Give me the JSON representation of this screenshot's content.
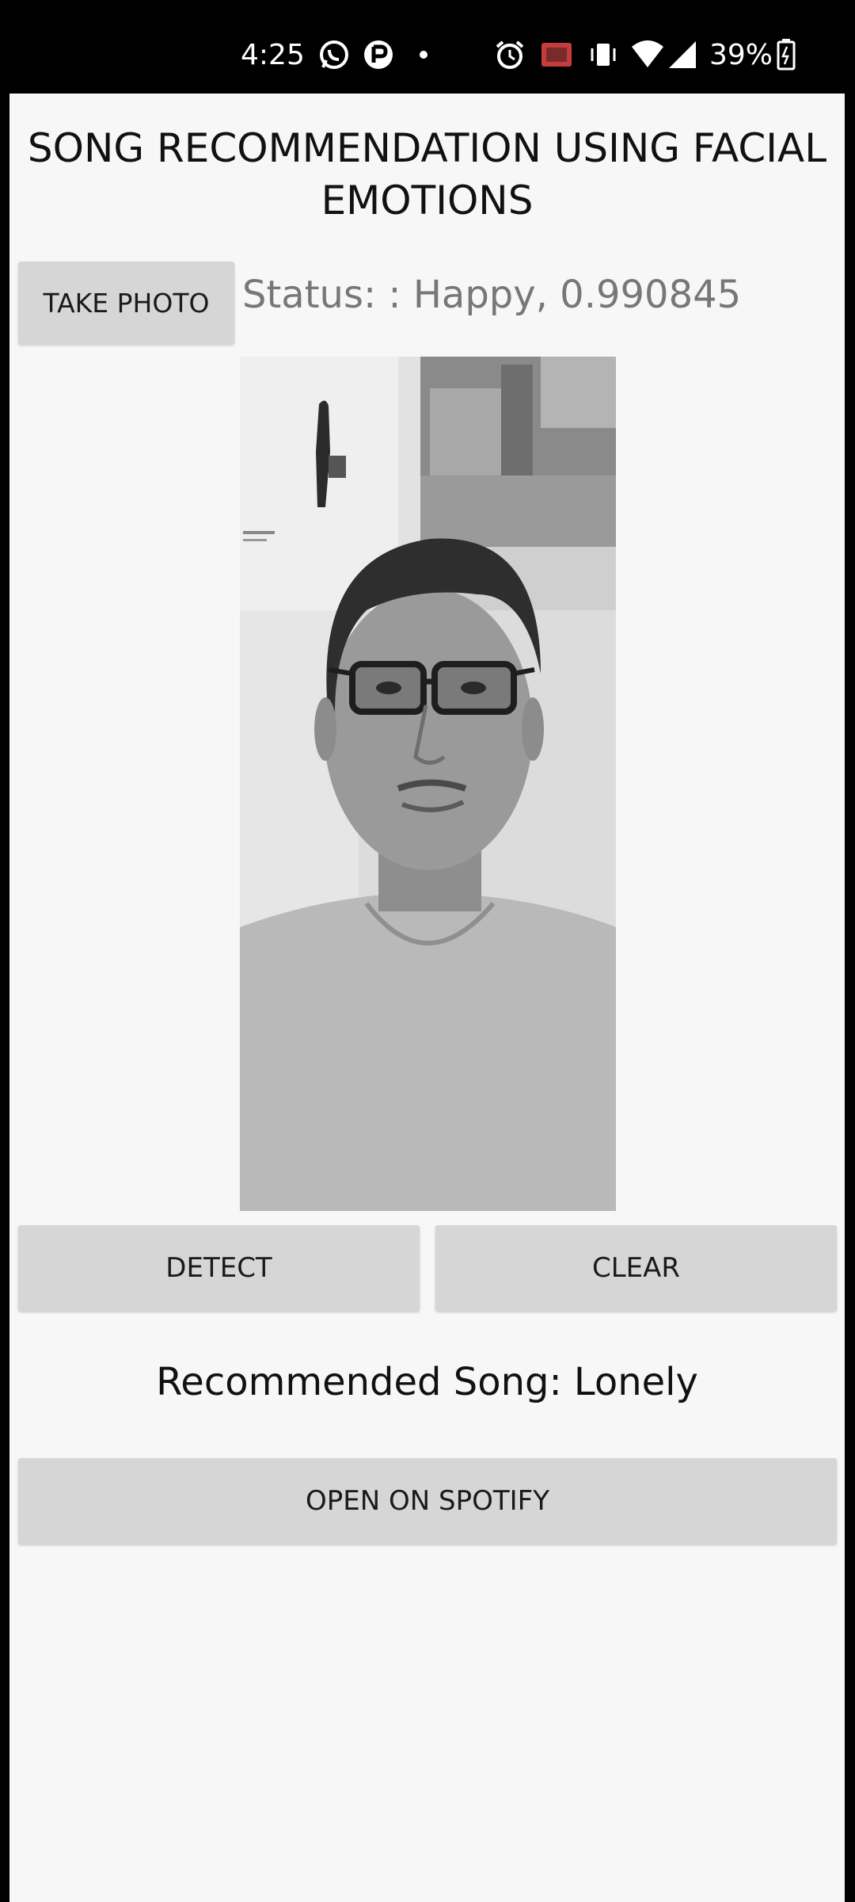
{
  "status_bar": {
    "time": "4:25",
    "battery_percent": "39%",
    "icons": [
      "whatsapp-icon",
      "app-icon",
      "dot-icon",
      "alarm-icon",
      "cast-icon",
      "vibrate-icon",
      "wifi-icon",
      "signal-icon",
      "battery-icon"
    ]
  },
  "app": {
    "title": "SONG RECOMMENDATION USING FACIAL EMOTIONS",
    "take_photo_label": "TAKE PHOTO",
    "status_text": "Status: : Happy, 0.990845",
    "detect_label": "DETECT",
    "clear_label": "CLEAR",
    "recommended_text": "Recommended Song: Lonely",
    "spotify_label": "OPEN ON SPOTIFY"
  },
  "colors": {
    "background": "#f7f7f7",
    "button": "#d6d6d6",
    "status_bar": "#000000"
  }
}
